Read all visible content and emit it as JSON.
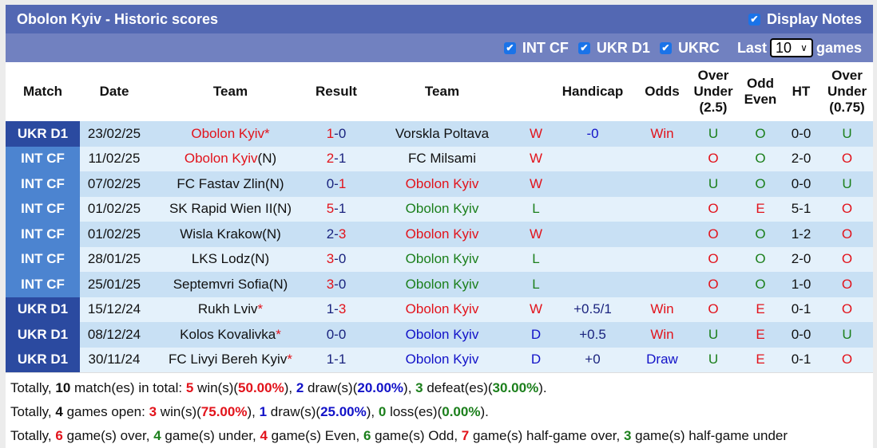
{
  "header": {
    "title": "Obolon Kyiv - Historic scores",
    "display_notes_label": "Display Notes",
    "display_notes_checked": true
  },
  "filters": {
    "items": [
      {
        "label": "INT CF",
        "checked": true
      },
      {
        "label": "UKR D1",
        "checked": true
      },
      {
        "label": "UKRC",
        "checked": true
      }
    ],
    "last_label": "Last",
    "last_value": "10",
    "games_label": "games"
  },
  "columns": [
    "Match",
    "Date",
    "Team",
    "Result",
    "Team",
    "",
    "Handicap",
    "Odds",
    "Over Under (2.5)",
    "Odd Even",
    "HT",
    "Over Under (0.75)"
  ],
  "rows": [
    {
      "league": "UKR D1",
      "league_type": "ukr",
      "date": "23/02/25",
      "home": "Obolon Kyiv",
      "home_suffix": "*",
      "home_color": "red",
      "score_home": "1",
      "score_away": "0",
      "away": "Vorskla Poltava",
      "away_suffix": "",
      "away_color": "black",
      "wdl": "W",
      "handicap": "-0",
      "odds": "Win",
      "ou": "U",
      "oe": "O",
      "ht": "0-0",
      "ou2": "U"
    },
    {
      "league": "INT CF",
      "league_type": "int",
      "date": "11/02/25",
      "home": "Obolon Kyiv",
      "home_suffix": "(N)",
      "home_color": "red",
      "score_home": "2",
      "score_away": "1",
      "away": "FC Milsami",
      "away_suffix": "",
      "away_color": "black",
      "wdl": "W",
      "handicap": "",
      "odds": "",
      "ou": "O",
      "oe": "O",
      "ht": "2-0",
      "ou2": "O"
    },
    {
      "league": "INT CF",
      "league_type": "int",
      "date": "07/02/25",
      "home": "FC Fastav Zlin",
      "home_suffix": "(N)",
      "home_color": "black",
      "score_home": "0",
      "score_away": "1",
      "away": "Obolon Kyiv",
      "away_suffix": "",
      "away_color": "red",
      "wdl": "W",
      "handicap": "",
      "odds": "",
      "ou": "U",
      "oe": "O",
      "ht": "0-0",
      "ou2": "U"
    },
    {
      "league": "INT CF",
      "league_type": "int",
      "date": "01/02/25",
      "home": "SK Rapid Wien II",
      "home_suffix": "(N)",
      "home_color": "black",
      "score_home": "5",
      "score_away": "1",
      "away": "Obolon Kyiv",
      "away_suffix": "",
      "away_color": "green",
      "wdl": "L",
      "handicap": "",
      "odds": "",
      "ou": "O",
      "oe": "E",
      "ht": "5-1",
      "ou2": "O"
    },
    {
      "league": "INT CF",
      "league_type": "int",
      "date": "01/02/25",
      "home": "Wisla Krakow",
      "home_suffix": "(N)",
      "home_color": "black",
      "score_home": "2",
      "score_away": "3",
      "away": "Obolon Kyiv",
      "away_suffix": "",
      "away_color": "red",
      "wdl": "W",
      "handicap": "",
      "odds": "",
      "ou": "O",
      "oe": "O",
      "ht": "1-2",
      "ou2": "O"
    },
    {
      "league": "INT CF",
      "league_type": "int",
      "date": "28/01/25",
      "home": "LKS Lodz",
      "home_suffix": "(N)",
      "home_color": "black",
      "score_home": "3",
      "score_away": "0",
      "away": "Obolon Kyiv",
      "away_suffix": "",
      "away_color": "green",
      "wdl": "L",
      "handicap": "",
      "odds": "",
      "ou": "O",
      "oe": "O",
      "ht": "2-0",
      "ou2": "O"
    },
    {
      "league": "INT CF",
      "league_type": "int",
      "date": "25/01/25",
      "home": "Septemvri Sofia",
      "home_suffix": "(N)",
      "home_color": "black",
      "score_home": "3",
      "score_away": "0",
      "away": "Obolon Kyiv",
      "away_suffix": "",
      "away_color": "green",
      "wdl": "L",
      "handicap": "",
      "odds": "",
      "ou": "O",
      "oe": "O",
      "ht": "1-0",
      "ou2": "O"
    },
    {
      "league": "UKR D1",
      "league_type": "ukr",
      "date": "15/12/24",
      "home": "Rukh Lviv",
      "home_suffix": "*",
      "home_color": "black",
      "score_home": "1",
      "score_away": "3",
      "away": "Obolon Kyiv",
      "away_suffix": "",
      "away_color": "red",
      "wdl": "W",
      "handicap": "+0.5/1",
      "odds": "Win",
      "ou": "O",
      "oe": "E",
      "ht": "0-1",
      "ou2": "O"
    },
    {
      "league": "UKR D1",
      "league_type": "ukr",
      "date": "08/12/24",
      "home": "Kolos Kovalivka",
      "home_suffix": "*",
      "home_color": "black",
      "score_home": "0",
      "score_away": "0",
      "away": "Obolon Kyiv",
      "away_suffix": "",
      "away_color": "blue",
      "wdl": "D",
      "handicap": "+0.5",
      "odds": "Win",
      "ou": "U",
      "oe": "E",
      "ht": "0-0",
      "ou2": "U"
    },
    {
      "league": "UKR D1",
      "league_type": "ukr",
      "date": "30/11/24",
      "home": "FC Livyi Bereh Kyiv",
      "home_suffix": "*",
      "home_color": "black",
      "score_home": "1",
      "score_away": "1",
      "away": "Obolon Kyiv",
      "away_suffix": "",
      "away_color": "blue",
      "wdl": "D",
      "handicap": "+0",
      "odds": "Draw",
      "ou": "U",
      "oe": "E",
      "ht": "0-1",
      "ou2": "O"
    }
  ],
  "summary": {
    "line1": {
      "prefix": "Totally, ",
      "total": "10",
      "t1": " match(es) in total: ",
      "wins": "5",
      "t2": " win(s)(",
      "win_pct": "50.00%",
      "t3": "), ",
      "draws": "2",
      "t4": " draw(s)(",
      "draw_pct": "20.00%",
      "t5": "), ",
      "defeats": "3",
      "t6": " defeat(es)(",
      "defeat_pct": "30.00%",
      "t7": ")."
    },
    "line2": {
      "prefix": "Totally, ",
      "open": "4",
      "t1": " games open: ",
      "wins": "3",
      "t2": " win(s)(",
      "win_pct": "75.00%",
      "t3": "), ",
      "draws": "1",
      "t4": " draw(s)(",
      "draw_pct": "25.00%",
      "t5": "), ",
      "losses": "0",
      "t6": " loss(es)(",
      "loss_pct": "0.00%",
      "t7": ")."
    },
    "line3": {
      "prefix": "Totally, ",
      "over": "6",
      "t1": " game(s) over, ",
      "under": "4",
      "t2": " game(s) under, ",
      "even": "4",
      "t3": " game(s) Even, ",
      "odd": "6",
      "t4": " game(s) Odd, ",
      "half_over": "7",
      "t5": " game(s) half-game over, ",
      "half_under": "3",
      "t6": " game(s) half-game under"
    }
  },
  "colors": {
    "title_bg": "#5368b3",
    "filter_bg": "#7181c0",
    "ukr_league": "#2b4aa0",
    "int_league": "#4c84d0",
    "row_odd": "#c8e0f4",
    "row_even": "#e4f1fb",
    "red": "#e2131b",
    "blue": "#1212c8",
    "green": "#1b7f1b"
  }
}
